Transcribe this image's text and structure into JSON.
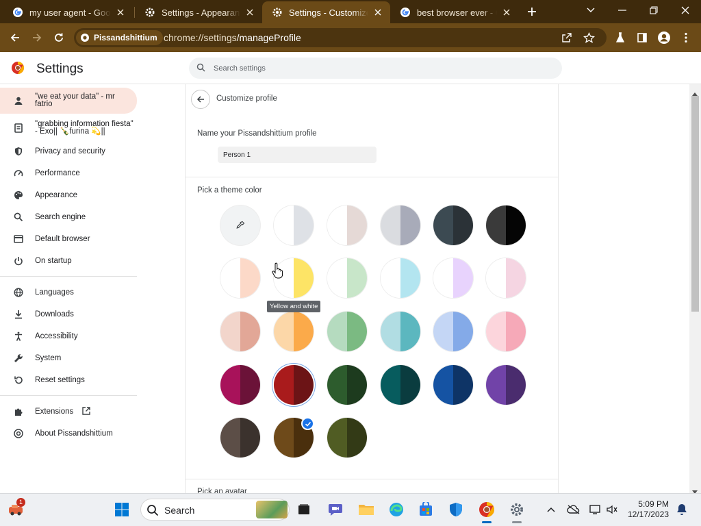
{
  "tabs": [
    {
      "title": "my user agent - Google Search"
    },
    {
      "title": "Settings - Appearance"
    },
    {
      "title": "Settings - Customize profile"
    },
    {
      "title": "best browser ever - Google Search"
    }
  ],
  "toolbar": {
    "site_chip": "Pissandshittium",
    "url_host": "chrome://settings",
    "url_path": "/manageProfile"
  },
  "settings": {
    "title": "Settings",
    "search_placeholder": "Search settings"
  },
  "sidebar": {
    "items": [
      {
        "label": "\"we eat your data\" - mr fatrio",
        "icon": "person-icon"
      },
      {
        "label": "\"grabbing information fiesta\" - Exo|| 🍾furina 💫||",
        "icon": "autofill-icon"
      },
      {
        "label": "Privacy and security",
        "icon": "shield-icon"
      },
      {
        "label": "Performance",
        "icon": "speedometer-icon"
      },
      {
        "label": "Appearance",
        "icon": "palette-icon"
      },
      {
        "label": "Search engine",
        "icon": "search-icon"
      },
      {
        "label": "Default browser",
        "icon": "browser-icon"
      },
      {
        "label": "On startup",
        "icon": "power-icon"
      },
      {
        "label": "Languages",
        "icon": "globe-icon"
      },
      {
        "label": "Downloads",
        "icon": "download-icon"
      },
      {
        "label": "Accessibility",
        "icon": "accessibility-icon"
      },
      {
        "label": "System",
        "icon": "wrench-icon"
      },
      {
        "label": "Reset settings",
        "icon": "reset-icon"
      },
      {
        "label": "Extensions",
        "icon": "puzzle-icon"
      },
      {
        "label": "About Pissandshittium",
        "icon": "chromium-icon"
      }
    ]
  },
  "profile": {
    "subpage_title": "Customize profile",
    "name_label": "Name your Pissandshittium profile",
    "name_value": "Person 1",
    "theme_label": "Pick a theme color",
    "avatar_label": "Pick an avatar",
    "tooltip": "Yellow and white",
    "selected_index": 19,
    "themes": [
      {
        "left": "#f1f3f4",
        "right": "#f1f3f4",
        "custom": true
      },
      {
        "left": "#ffffff",
        "right": "#dee1e6"
      },
      {
        "left": "#ffffff",
        "right": "#e5d9d6"
      },
      {
        "left": "#dadce0",
        "right": "#a8abb9"
      },
      {
        "left": "#3c4a52",
        "right": "#2b3237"
      },
      {
        "left": "#3a3a3a",
        "right": "#050505"
      },
      {
        "left": "#ffffff",
        "right": "#fcd9c8"
      },
      {
        "left": "#ffffff",
        "right": "#fde466"
      },
      {
        "left": "#ffffff",
        "right": "#c8e6c9"
      },
      {
        "left": "#ffffff",
        "right": "#b3e5f0"
      },
      {
        "left": "#ffffff",
        "right": "#e8d3fd"
      },
      {
        "left": "#ffffff",
        "right": "#f5d5e2"
      },
      {
        "left": "#f2d5cb",
        "right": "#e2a797"
      },
      {
        "left": "#fcd7a8",
        "right": "#fbaa4a"
      },
      {
        "left": "#b5dbbf",
        "right": "#7bba82"
      },
      {
        "left": "#b1dde3",
        "right": "#5cb7bf"
      },
      {
        "left": "#c4d6f5",
        "right": "#84aae8"
      },
      {
        "left": "#fcd5dc",
        "right": "#f6a9b8"
      },
      {
        "left": "#a8125a",
        "right": "#6b1238"
      },
      {
        "left": "#a91b1c",
        "right": "#6c1416"
      },
      {
        "left": "#2d5c2d",
        "right": "#1d3b1e"
      },
      {
        "left": "#075c5e",
        "right": "#0a3c3f"
      },
      {
        "left": "#1553a3",
        "right": "#0e3466"
      },
      {
        "left": "#7143a8",
        "right": "#4a2c6e"
      },
      {
        "left": "#5c4e47",
        "right": "#3b322d"
      },
      {
        "left": "#6e4a1a",
        "right": "#4a2f0d"
      },
      {
        "left": "#505c23",
        "right": "#333a16"
      }
    ]
  },
  "taskbar": {
    "search_label": "Search",
    "time": "5:09 PM",
    "date": "12/17/2023",
    "badge": "1"
  }
}
